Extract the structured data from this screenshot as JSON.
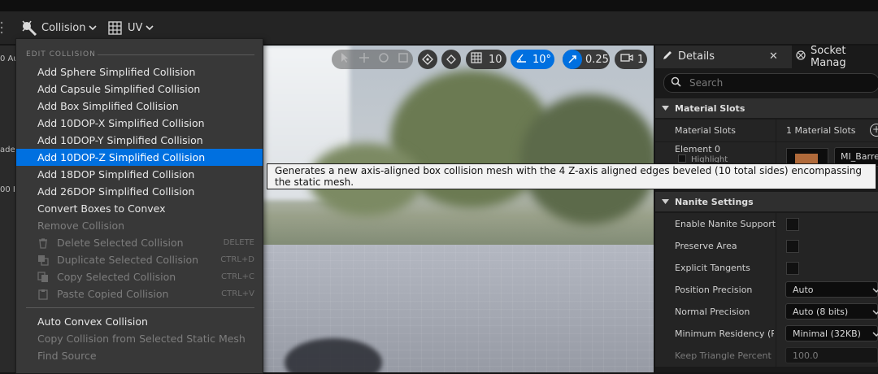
{
  "toolbar": {
    "collision_label": "Collision",
    "uv_label": "UV"
  },
  "left_edge": {
    "text1": "0 Au",
    "text2": "ade",
    "text3": "00 I"
  },
  "viewport": {
    "snap_grid_value": "10",
    "snap_rotate_value": "10°",
    "snap_scale_value": "0.25",
    "camera_speed_value": "1"
  },
  "menu": {
    "section_edit": "EDIT COLLISION",
    "items": [
      {
        "label": "Add Sphere Simplified Collision"
      },
      {
        "label": "Add Capsule Simplified Collision"
      },
      {
        "label": "Add Box Simplified Collision"
      },
      {
        "label": "Add 10DOP-X Simplified Collision"
      },
      {
        "label": "Add 10DOP-Y Simplified Collision"
      },
      {
        "label": "Add 10DOP-Z Simplified Collision"
      },
      {
        "label": "Add 18DOP Simplified Collision"
      },
      {
        "label": "Add 26DOP Simplified Collision"
      },
      {
        "label": "Convert Boxes to Convex"
      },
      {
        "label": "Remove Collision"
      },
      {
        "label": "Delete Selected Collision",
        "shortcut": "DELETE"
      },
      {
        "label": "Duplicate Selected Collision",
        "shortcut": "CTRL+D"
      },
      {
        "label": "Copy Selected Collision",
        "shortcut": "CTRL+C"
      },
      {
        "label": "Paste Copied Collision",
        "shortcut": "CTRL+V"
      },
      {
        "label": "Auto Convex Collision"
      },
      {
        "label": "Copy Collision from Selected Static Mesh"
      },
      {
        "label": "Find Source"
      }
    ],
    "highlight_color": "#0070e0"
  },
  "tooltip": {
    "text": "Generates a new axis-aligned box collision mesh with the 4 Z-axis aligned edges beveled (10 total sides) encompassing the static mesh."
  },
  "details": {
    "tab_details": "Details",
    "tab_socket": "Socket Manag",
    "search_placeholder": "Search",
    "cat_material_slots": "Material Slots",
    "material_slots_label": "Material Slots",
    "material_slots_value": "1 Material Slots",
    "element0_label": "Element 0",
    "element0_sub": "Highlight",
    "material_name": "MI_Barre",
    "cat_nanite": "Nanite Settings",
    "rows": [
      {
        "label": "Enable Nanite Support"
      },
      {
        "label": "Preserve Area"
      },
      {
        "label": "Explicit Tangents"
      },
      {
        "label": "Position Precision",
        "value": "Auto"
      },
      {
        "label": "Normal Precision",
        "value": "Auto (8 bits)"
      },
      {
        "label": "Minimum Residency (Ro",
        "value": "Minimal (32KB)"
      },
      {
        "label": "Keep Triangle Percent",
        "value": "100.0"
      }
    ],
    "accent_color": "#3b8ee8"
  }
}
